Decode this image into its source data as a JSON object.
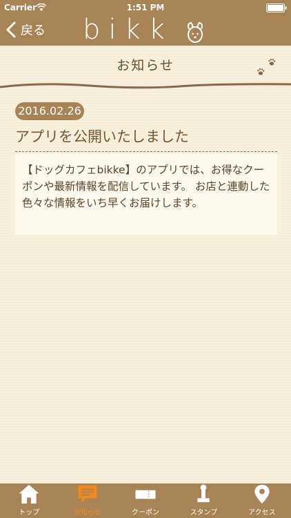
{
  "status_bar": {
    "carrier": "Carrier",
    "time": "1:51 PM"
  },
  "nav": {
    "back_label": "戻る",
    "logo_text": "bikk"
  },
  "page": {
    "title": "お知らせ"
  },
  "news": {
    "date": "2016.02.26",
    "title": "アプリを公開いたしました",
    "body": "【ドッグカフェbikke】のアプリでは、お得なクーポンや最新情報を配信しています。 お店と連動した色々な情報をいち早くお届けします。"
  },
  "tabs": [
    {
      "label": "トップ",
      "icon": "home-icon",
      "active": false
    },
    {
      "label": "お知らせ",
      "icon": "chat-icon",
      "active": true
    },
    {
      "label": "クーポン",
      "icon": "ticket-icon",
      "active": false
    },
    {
      "label": "スタンプ",
      "icon": "stamp-icon",
      "active": false
    },
    {
      "label": "アクセス",
      "icon": "location-icon",
      "active": false
    }
  ],
  "colors": {
    "brand": "#a88355",
    "background": "#f7f0dc",
    "active_tab": "#f08a1c",
    "text_brown": "#7a5530"
  }
}
